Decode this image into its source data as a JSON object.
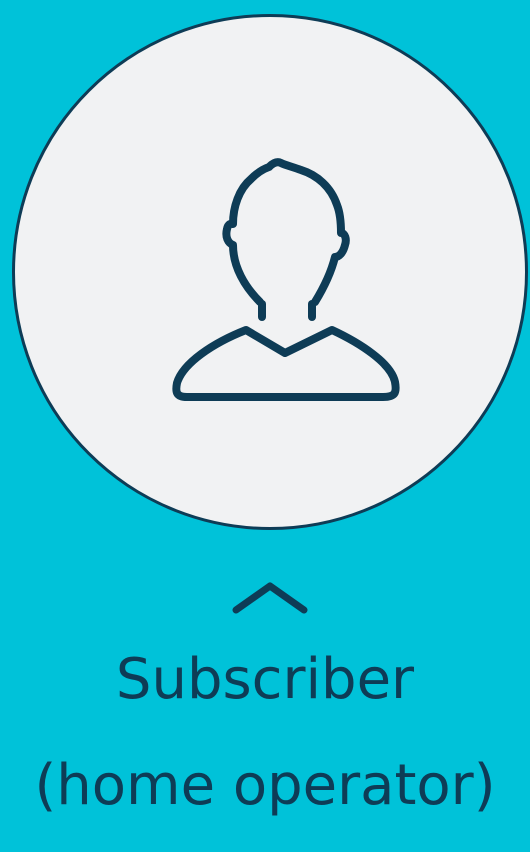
{
  "colors": {
    "background": "#00C2D9",
    "circle_fill": "#F1F2F3",
    "stroke": "#0E3C56",
    "text": "#0E3C56"
  },
  "icons": {
    "avatar": "person-outline-icon",
    "caret": "chevron-up-icon"
  },
  "label": {
    "line1": "Subscriber",
    "line2": "(home operator)"
  }
}
